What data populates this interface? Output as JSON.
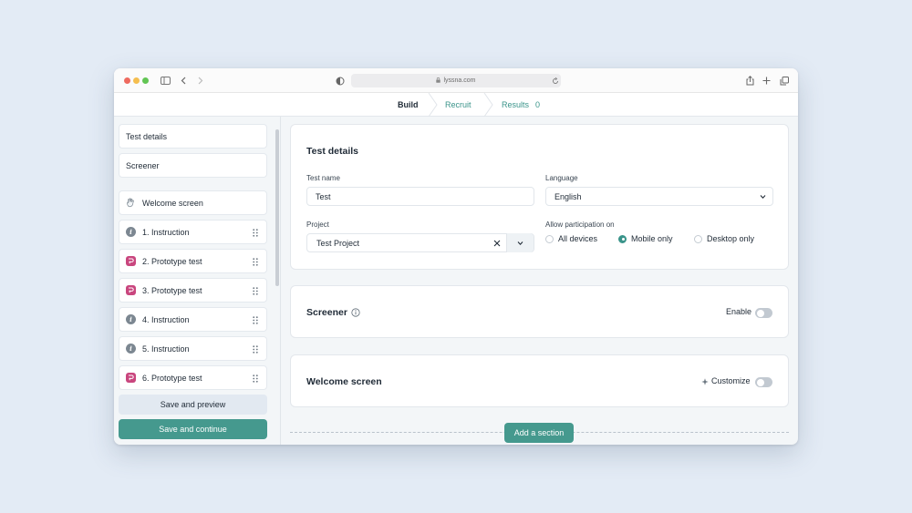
{
  "browser": {
    "url": "lyssna.com"
  },
  "tabs": [
    {
      "label": "Build"
    },
    {
      "label": "Recruit"
    },
    {
      "label": "Results",
      "count": "0"
    }
  ],
  "sidebar": {
    "test_details": "Test details",
    "screener": "Screener",
    "welcome": "Welcome screen",
    "items": [
      {
        "label": "1. Instruction",
        "icon": "info-icon"
      },
      {
        "label": "2. Prototype test",
        "icon": "prototype-icon"
      },
      {
        "label": "3. Prototype test",
        "icon": "prototype-icon"
      },
      {
        "label": "4. Instruction",
        "icon": "info-icon"
      },
      {
        "label": "5. Instruction",
        "icon": "info-icon"
      },
      {
        "label": "6. Prototype test",
        "icon": "prototype-icon"
      }
    ],
    "save_preview": "Save and preview",
    "save_continue": "Save and continue"
  },
  "test_details": {
    "title": "Test details",
    "test_name_label": "Test name",
    "test_name_value": "Test",
    "language_label": "Language",
    "language_value": "English",
    "project_label": "Project",
    "project_value": "Test Project",
    "participation_label": "Allow participation on",
    "participation_options": [
      "All devices",
      "Mobile only",
      "Desktop only"
    ],
    "participation_selected": "Mobile only"
  },
  "screener_card": {
    "title": "Screener",
    "toggle_label": "Enable",
    "enabled": false
  },
  "welcome_card": {
    "title": "Welcome screen",
    "toggle_label": "Customize",
    "enabled": false
  },
  "add_section": "Add a section",
  "colors": {
    "accent": "#3a948a",
    "button_primary": "#45998e",
    "prototype_icon": "#c9467e",
    "background": "#e3ebf5"
  }
}
